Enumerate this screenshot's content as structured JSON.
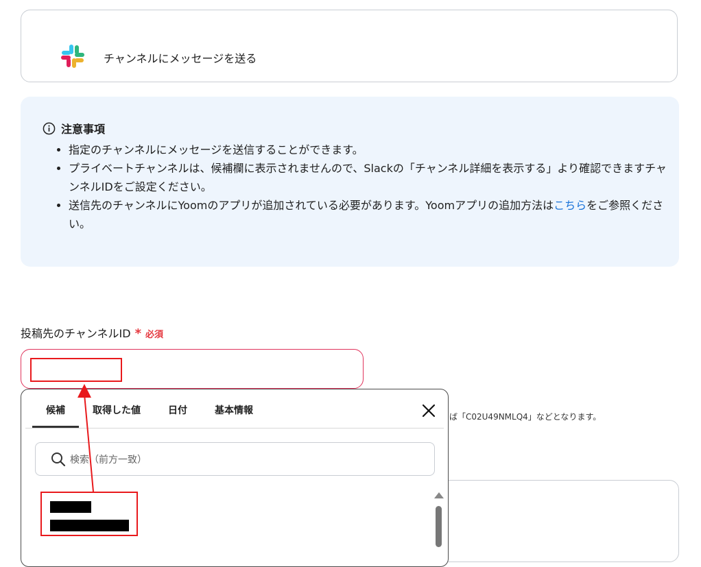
{
  "action": {
    "label": "チャンネルにメッセージを送る",
    "icon": "slack-logo"
  },
  "notice": {
    "title": "注意事項",
    "items": [
      "指定のチャンネルにメッセージを送信することができます。",
      "プライベートチャンネルは、候補欄に表示されませんので、Slackの「チャンネル詳細を表示する」より確認できますチャンネルIDをご設定ください。"
    ],
    "item3_pre": "送信先のチャンネルにYoomのアプリが追加されている必要があります。Yoomアプリの追加方法は",
    "item3_link": "こちら",
    "item3_post": "をご参照ください。"
  },
  "field": {
    "label": "投稿先のチャンネルID",
    "required_mark": "*",
    "required_text": "必須",
    "value": "",
    "hint": "ば「C02U49NMLQ4」などとなります。"
  },
  "popup": {
    "tabs": [
      "候補",
      "取得した値",
      "日付",
      "基本情報"
    ],
    "active_tab": "候補",
    "search_placeholder": "検索（前方一致）"
  },
  "colors": {
    "required": "#e5383f",
    "link": "#1a73d9",
    "annotation": "#e8191c",
    "notice_bg": "#eef5fd"
  }
}
